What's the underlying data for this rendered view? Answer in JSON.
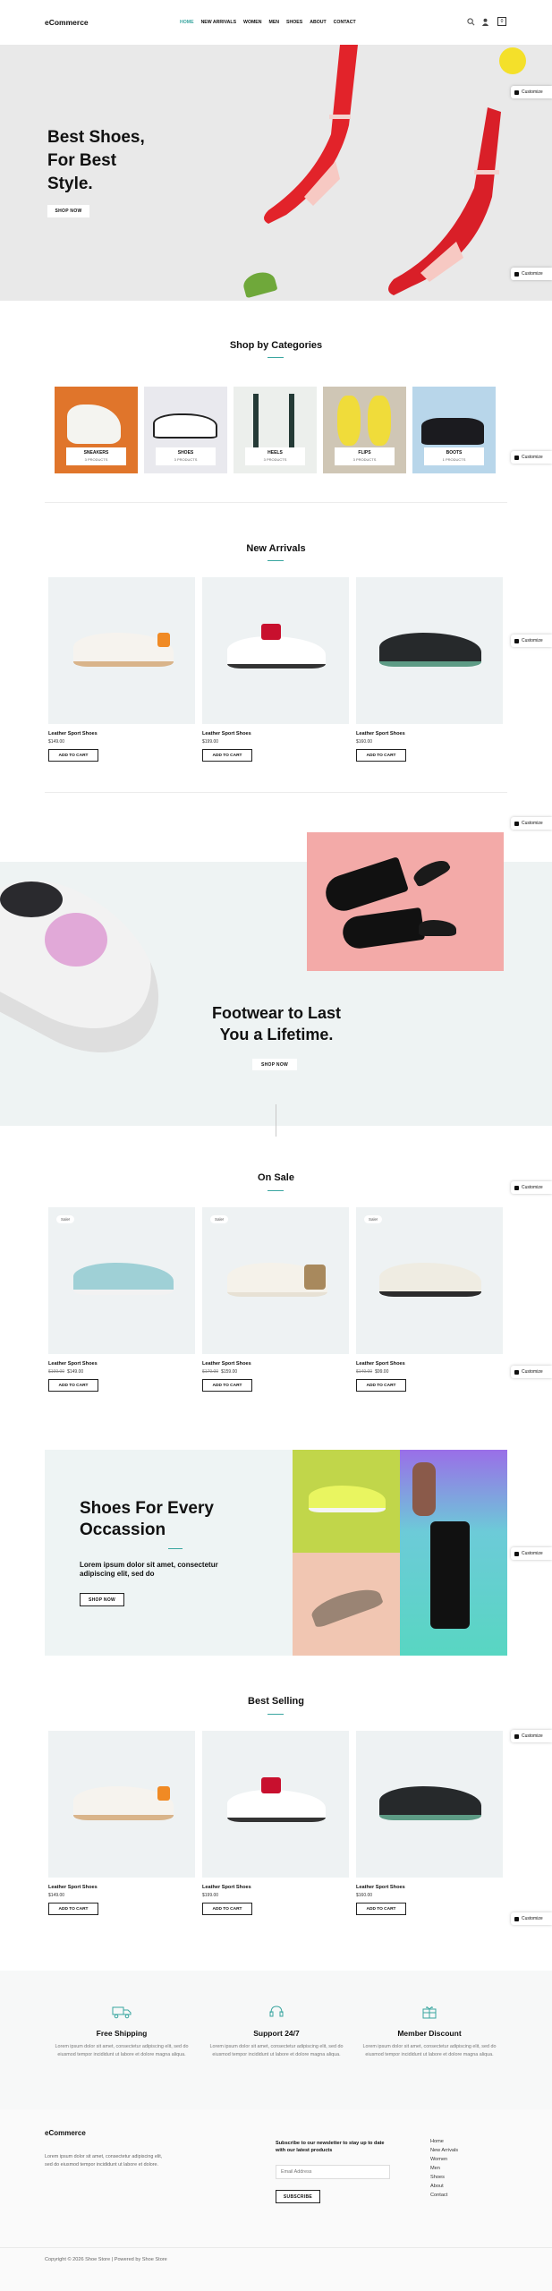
{
  "header": {
    "logo": "eCommerce",
    "nav": [
      "HOME",
      "NEW ARRIVALS",
      "WOMEN",
      "MEN",
      "SHOES",
      "ABOUT",
      "CONTACT"
    ],
    "cart_count": "0",
    "icons": [
      "search-icon",
      "user-icon",
      "cart-icon"
    ]
  },
  "hero": {
    "headline_1": "Best Shoes,",
    "headline_2": "For Best",
    "headline_3": "Style.",
    "cta": "SHOP NOW"
  },
  "customize_label": "Customize",
  "categories": {
    "title": "Shop by Categories",
    "items": [
      {
        "name": "SNEAKERS",
        "count": "3 PRODUCTS"
      },
      {
        "name": "SHOES",
        "count": "3 PRODUCTS"
      },
      {
        "name": "HEELS",
        "count": "3 PRODUCTS"
      },
      {
        "name": "FLIPS",
        "count": "3 PRODUCTS"
      },
      {
        "name": "BOOTS",
        "count": "1 PRODUCTS"
      }
    ]
  },
  "new_arrivals": {
    "title": "New Arrivals",
    "products": [
      {
        "name": "Leather Sport Shoes",
        "price": "$149.00",
        "button": "ADD TO CART"
      },
      {
        "name": "Leather Sport Shoes",
        "price": "$199.00",
        "button": "ADD TO CART"
      },
      {
        "name": "Leather Sport Shoes",
        "price": "$160.00",
        "button": "ADD TO CART"
      }
    ]
  },
  "promo": {
    "headline_1": "Footwear to Last",
    "headline_2": "You a Lifetime.",
    "cta": "SHOP NOW"
  },
  "on_sale": {
    "title": "On Sale",
    "badge": "Sale!",
    "products": [
      {
        "name": "Leather Sport Shoes",
        "old_price": "$199.00",
        "price": "$149.00",
        "button": "ADD TO CART"
      },
      {
        "name": "Leather Sport Shoes",
        "old_price": "$179.00",
        "price": "$159.00",
        "button": "ADD TO CART"
      },
      {
        "name": "Leather Sport Shoes",
        "old_price": "$149.00",
        "price": "$99.00",
        "button": "ADD TO CART"
      }
    ]
  },
  "occasion": {
    "headline_1": "Shoes For Every",
    "headline_2": "Occassion",
    "sub": "Lorem ipsum dolor sit amet, consectetur adipiscing elit, sed do",
    "cta": "SHOP NOW"
  },
  "best_selling": {
    "title": "Best Selling",
    "products": [
      {
        "name": "Leather Sport Shoes",
        "price": "$149.00",
        "button": "ADD TO CART"
      },
      {
        "name": "Leather Sport Shoes",
        "price": "$199.00",
        "button": "ADD TO CART"
      },
      {
        "name": "Leather Sport Shoes",
        "price": "$160.00",
        "button": "ADD TO CART"
      }
    ]
  },
  "features": [
    {
      "title": "Free Shipping",
      "text": "Lorem ipsum dolor sit amet, consectetur adipiscing elit, sed do eiusmod tempor incididunt ut labore et dolore magna aliqua."
    },
    {
      "title": "Support 24/7",
      "text": "Lorem ipsum dolor sit amet, consectetur adipiscing elit, sed do eiusmod tempor incididunt ut labore et dolore magna aliqua."
    },
    {
      "title": "Member Discount",
      "text": "Lorem ipsum dolor sit amet, consectetur adipiscing elit, sed do eiusmod tempor incididunt ut labore et dolore magna aliqua."
    }
  ],
  "footer": {
    "logo": "eCommerce",
    "about": "Lorem ipsum dolor sit amet, consectetur adipiscing elit, sed do eiusmod tempor incididunt ut labore et dolore.",
    "newsletter_title": "Subscribe to our newsletter to stay up to date with our latest products",
    "email_placeholder": "Email Address",
    "subscribe": "SUBSCRIBE",
    "links": [
      "Home",
      "New Arrivals",
      "Women",
      "Men",
      "Shoes",
      "About",
      "Contact"
    ],
    "copyright": "Copyright © 2026 Shoe Store | Powered by Shoe Store"
  },
  "colors": {
    "accent": "#3aa6a0",
    "hero_bg": "#e9e9e9",
    "pink": "#f3aaa8",
    "light": "#eef2f3"
  }
}
